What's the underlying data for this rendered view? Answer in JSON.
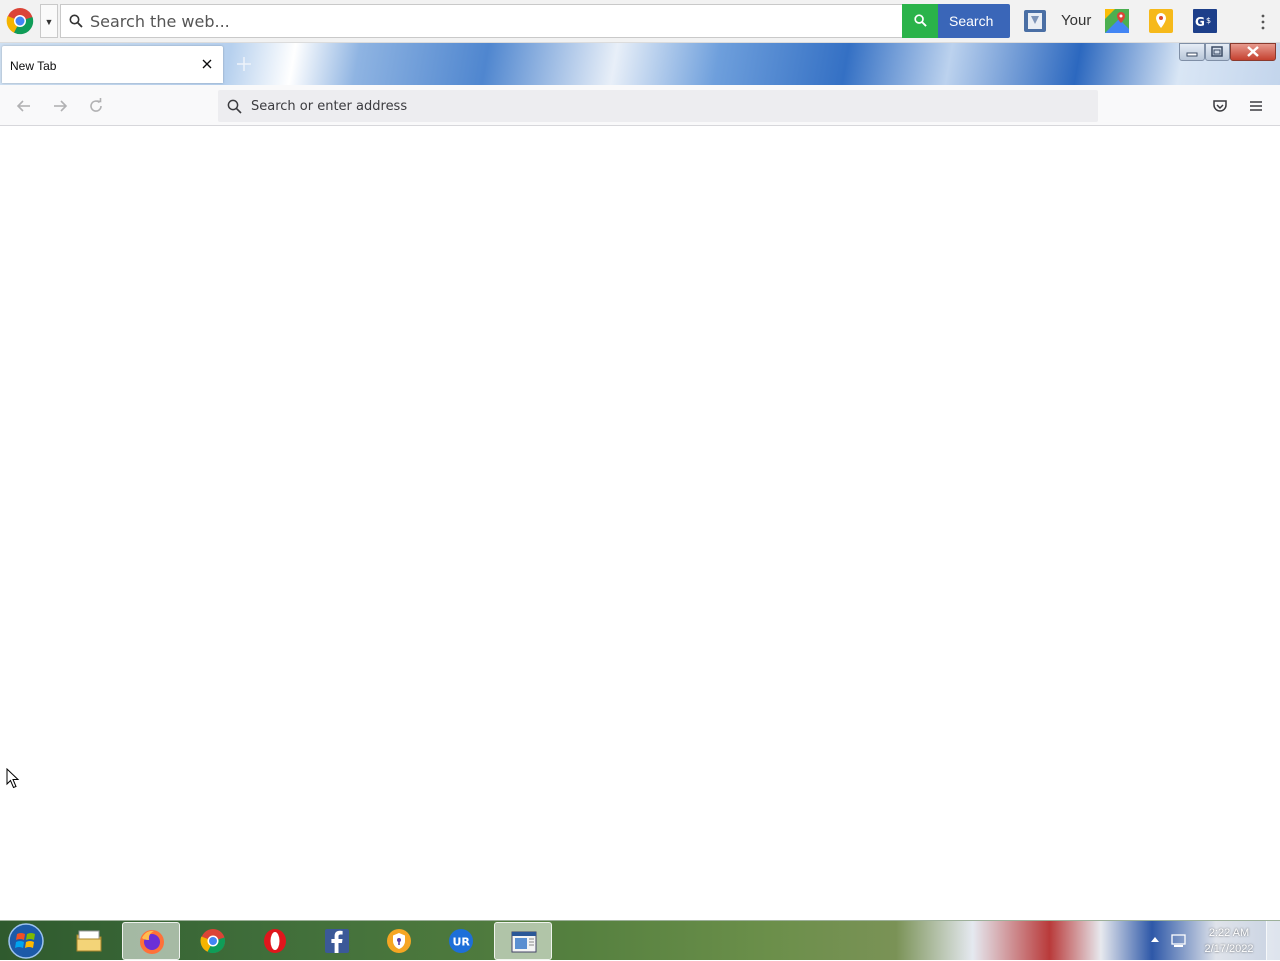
{
  "extension_toolbar": {
    "search_placeholder": "Search the web...",
    "search_button_label": "Search",
    "shortcut_label": "Your",
    "accent_green": "#2ab34a",
    "accent_blue": "#3a66b8"
  },
  "tabs": [
    {
      "title": "New Tab",
      "active": true
    }
  ],
  "navbar": {
    "address_placeholder": "Search or enter address"
  },
  "taskbar": {
    "pinned": [
      "file-explorer-icon",
      "firefox-icon",
      "chrome-icon",
      "opera-icon",
      "facebook-icon",
      "vpn-shield-icon",
      "ur-browser-icon",
      "window-app-icon"
    ],
    "active_app": "firefox-icon",
    "clock_time": "2:22 AM",
    "clock_date": "2/17/2022"
  }
}
